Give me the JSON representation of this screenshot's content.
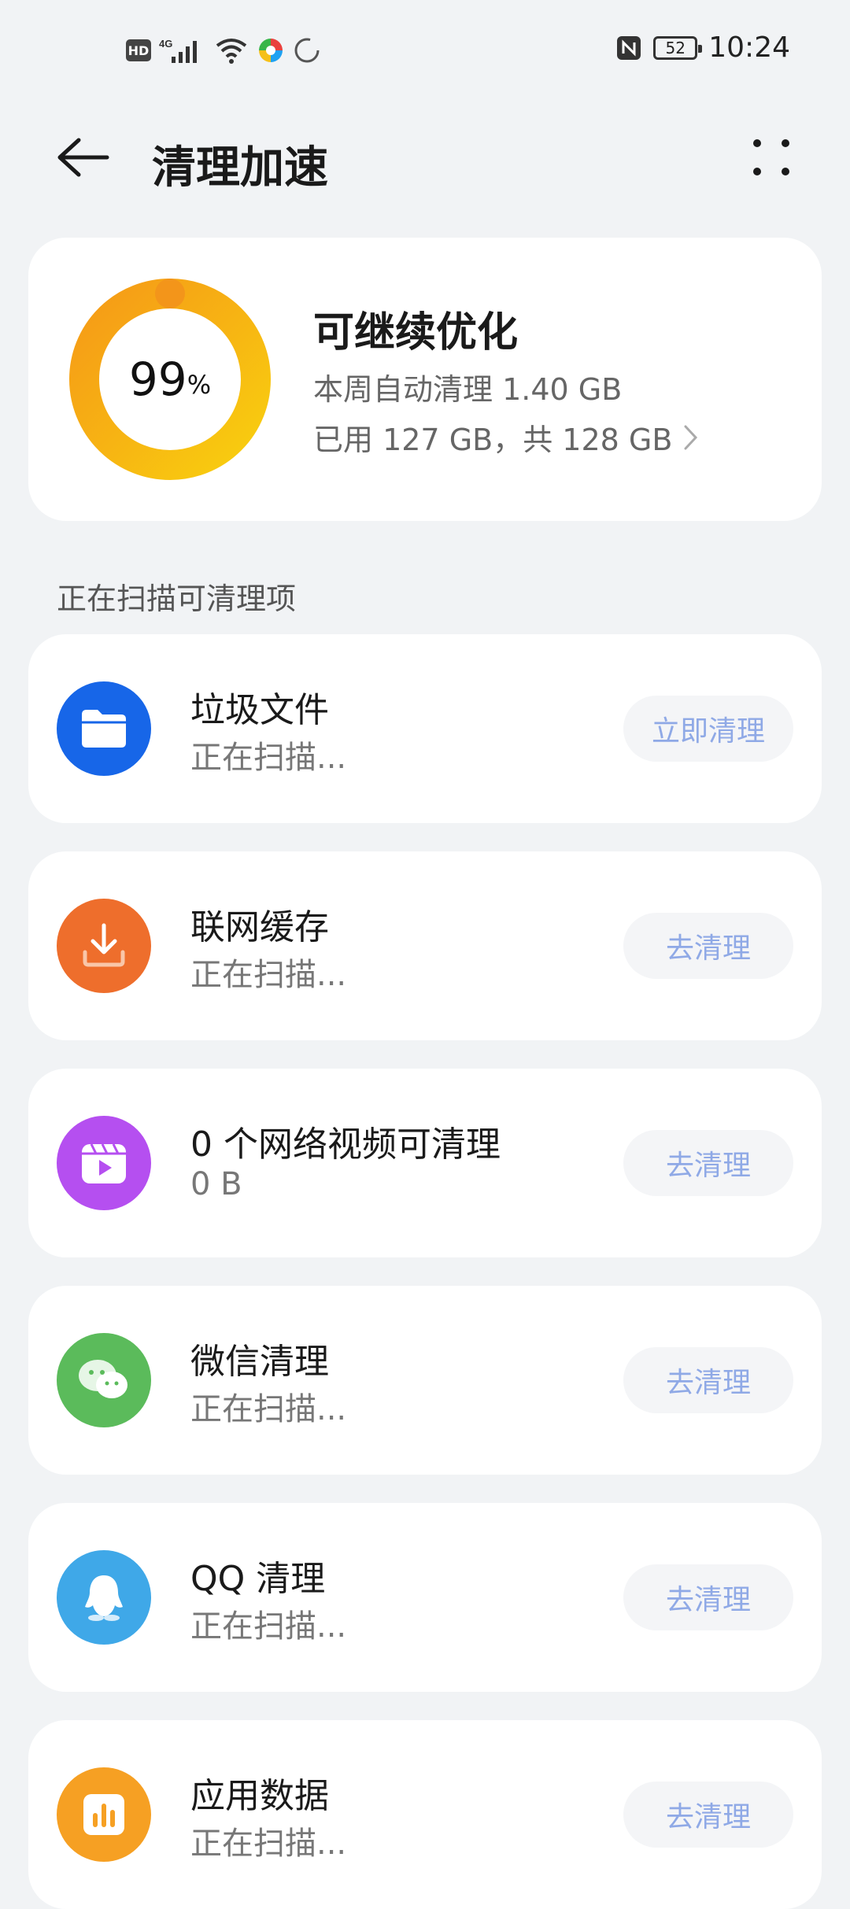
{
  "status_bar": {
    "hd_label": "HD",
    "network_label": "4G",
    "battery": "52",
    "time": "10:24"
  },
  "header": {
    "title": "清理加速"
  },
  "summary": {
    "percent": "99",
    "percent_unit": "%",
    "title": "可继续优化",
    "auto_cleaned": "本周自动清理 1.40 GB",
    "storage": "已用 127 GB，共 128 GB"
  },
  "section_title": "正在扫描可清理项",
  "items": [
    {
      "title": "垃圾文件",
      "subtitle": "正在扫描...",
      "button": "立即清理",
      "icon": "folder-icon",
      "color": "#1766e8"
    },
    {
      "title": "联网缓存",
      "subtitle": "正在扫描...",
      "button": "去清理",
      "icon": "download-icon",
      "color": "#ee6e2c"
    },
    {
      "title": "0 个网络视频可清理",
      "subtitle": "0 B",
      "button": "去清理",
      "icon": "video-icon",
      "color": "#b54ff0"
    },
    {
      "title": "微信清理",
      "subtitle": "正在扫描...",
      "button": "去清理",
      "icon": "wechat-icon",
      "color": "#5bbb5b"
    },
    {
      "title": "QQ 清理",
      "subtitle": "正在扫描...",
      "button": "去清理",
      "icon": "qq-icon",
      "color": "#3fa8e8"
    },
    {
      "title": "应用数据",
      "subtitle": "正在扫描...",
      "button": "去清理",
      "icon": "app-data-icon",
      "color": "#f6a023"
    }
  ]
}
